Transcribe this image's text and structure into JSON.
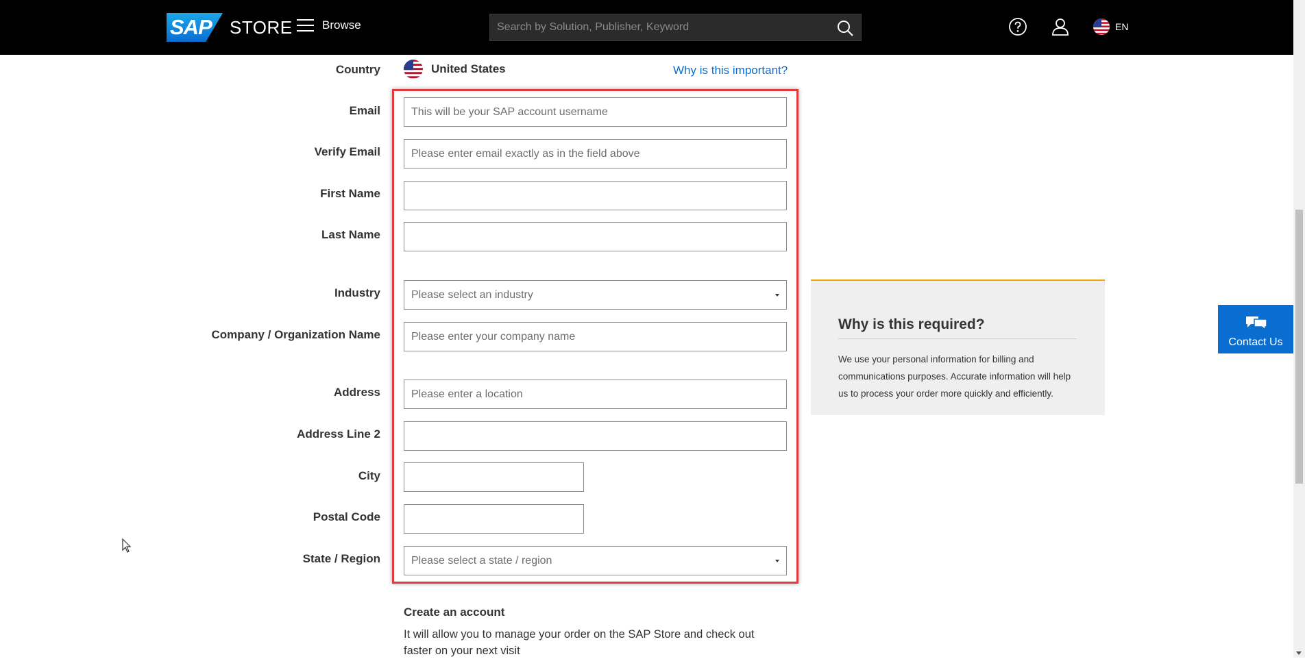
{
  "header": {
    "logo_sap": "SAP",
    "logo_store": "STORE",
    "browse_label": "Browse",
    "search_placeholder": "Search by Solution, Publisher, Keyword",
    "language": "EN",
    "icons": [
      "hamburger-icon",
      "search-icon",
      "help-icon",
      "user-icon",
      "us-flag-icon"
    ]
  },
  "form": {
    "country": {
      "label": "Country",
      "value": "United States",
      "link": "Why is this important?"
    },
    "email": {
      "label": "Email",
      "placeholder": "This will be your SAP account username",
      "value": ""
    },
    "verify_email": {
      "label": "Verify Email",
      "placeholder": "Please enter email exactly as in the field above",
      "value": ""
    },
    "first_name": {
      "label": "First Name",
      "value": ""
    },
    "last_name": {
      "label": "Last Name",
      "value": ""
    },
    "industry": {
      "label": "Industry",
      "selected": "Please select an industry"
    },
    "company": {
      "label": "Company / Organization Name",
      "placeholder": "Please enter your company name",
      "value": ""
    },
    "address": {
      "label": "Address",
      "placeholder": "Please enter a location",
      "value": ""
    },
    "address2": {
      "label": "Address Line 2",
      "value": ""
    },
    "city": {
      "label": "City",
      "value": ""
    },
    "postal_code": {
      "label": "Postal Code",
      "value": ""
    },
    "state": {
      "label": "State / Region",
      "selected": "Please select a state / region"
    }
  },
  "info": {
    "title": "Why is this required?",
    "text": "We use your personal information for billing and communications purposes. Accurate information will help us to process your order more quickly and efficiently."
  },
  "contact": {
    "label": "Contact Us"
  },
  "account": {
    "title": "Create an account",
    "text": "It will allow you to manage your order on the SAP Store and check out faster on your next visit"
  },
  "colors": {
    "accent": "#0a6ed1",
    "highlight": "#e33a3f",
    "info_border": "#e9a700"
  }
}
